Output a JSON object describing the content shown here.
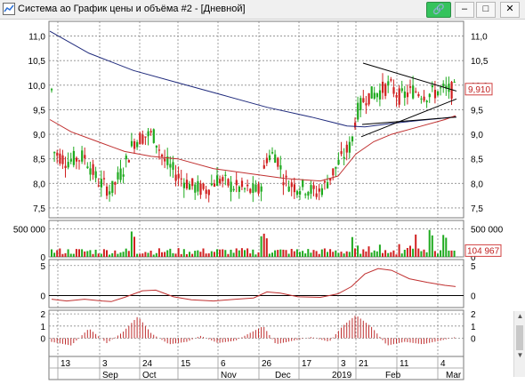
{
  "window": {
    "title": "Система ао График цены и объёма #2 - [Дневной]",
    "link_icon": "link-icon",
    "buttons": [
      "minimize",
      "maximize",
      "close"
    ]
  },
  "price_panel": {
    "y_ticks": [
      "11,0",
      "10,5",
      "10,0",
      "9,5",
      "9,0",
      "8,5",
      "8,0",
      "7,5"
    ],
    "last_price": "9,910"
  },
  "volume_panel": {
    "y_ticks": [
      "500 000",
      "0"
    ],
    "last_volume": "104 967"
  },
  "oscillator_panel": {
    "y_ticks": [
      "5",
      "0"
    ]
  },
  "histogram_panel": {
    "y_ticks": [
      "2",
      "1",
      "0"
    ]
  },
  "time_axis": {
    "day_labels": [
      "13",
      "3",
      "24",
      "15",
      "6",
      "26",
      "17",
      "3",
      "21",
      "11",
      "4"
    ],
    "month_labels": [
      "Sep",
      "Oct",
      "Nov",
      "Dec",
      "2019",
      "Feb",
      "Mar"
    ]
  },
  "colors": {
    "up_candle": "#1faa1f",
    "down_candle": "#d02020",
    "slow_ma": "#1f2a7c",
    "fast_ma": "#c03030",
    "grid": "#8a8a8a",
    "price_marker_border": "#d04040"
  },
  "chart_data": {
    "type": "candlestick",
    "price_axis_range": [
      7.3,
      11.3
    ],
    "volume_axis_range": [
      0,
      650000
    ],
    "oscillator_axis_range": [
      -2,
      6
    ],
    "histogram_axis_range": [
      -1.5,
      2.3
    ],
    "grid": true
  }
}
